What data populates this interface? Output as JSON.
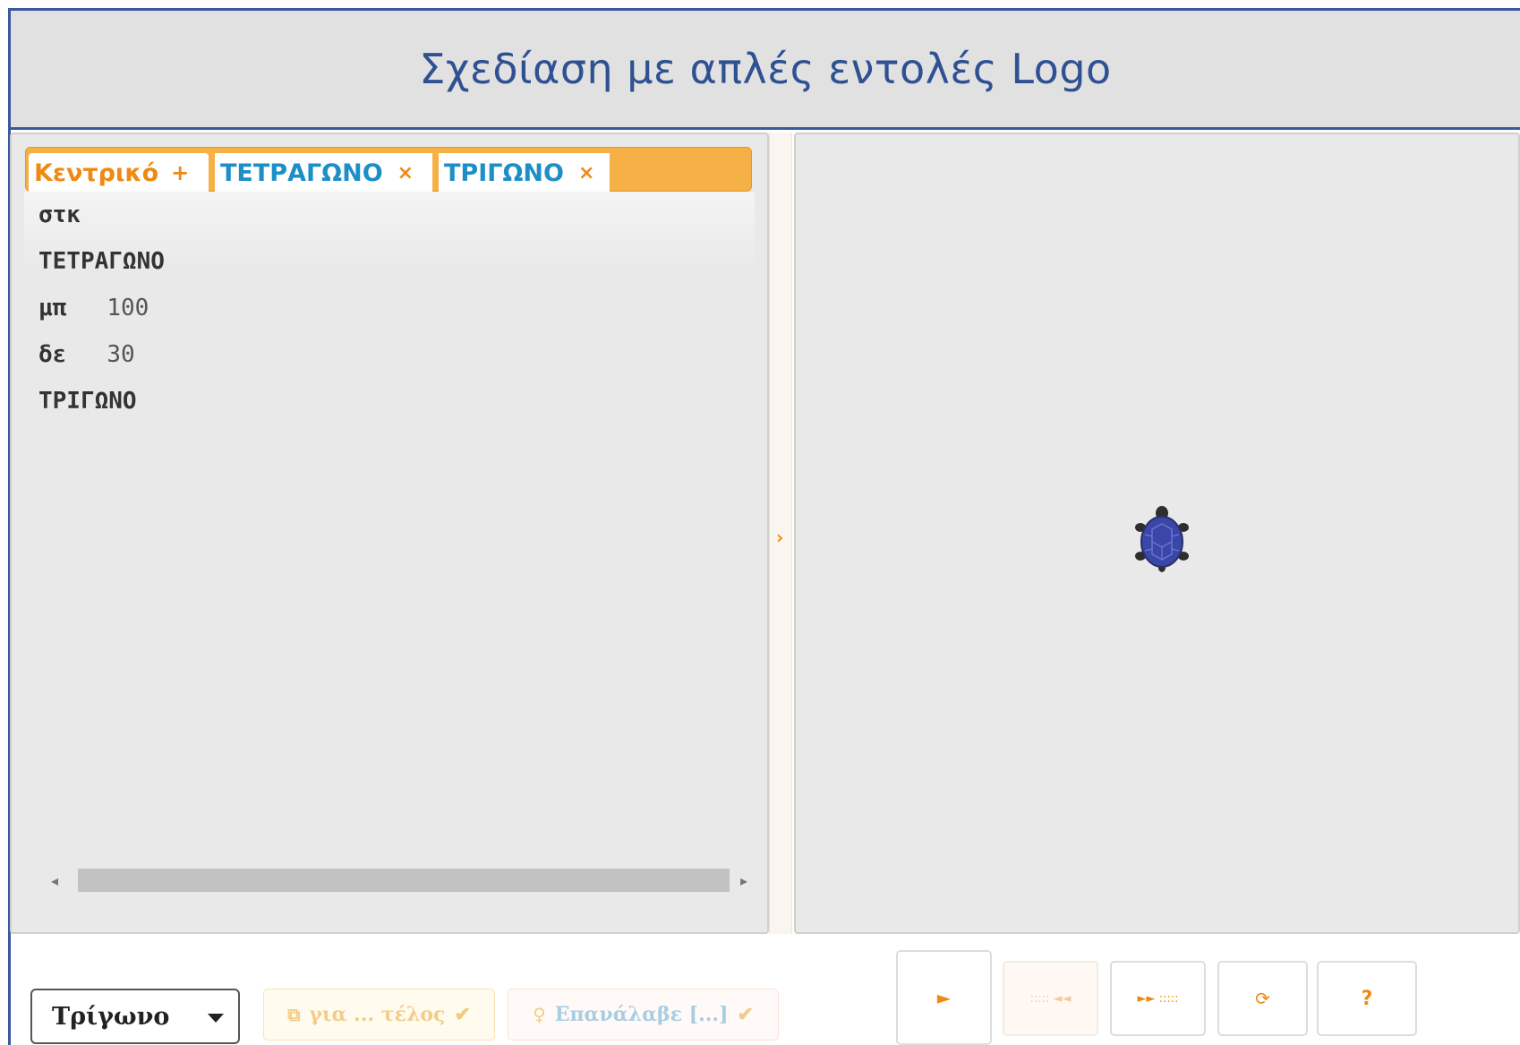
{
  "header": {
    "title": "Σχεδίαση με απλές εντολές Logo"
  },
  "tabs": {
    "main": {
      "label": "Κεντρικό",
      "action": "+"
    },
    "square": {
      "label": "ΤΕΤΡΑΓΩΝΟ",
      "action": "×"
    },
    "triangle": {
      "label": "ΤΡΙΓΩΝΟ",
      "action": "×"
    }
  },
  "code": {
    "lines": [
      {
        "cmd": "στκ",
        "arg": ""
      },
      {
        "cmd": "ΤΕΤΡΑΓΩΝΟ",
        "arg": ""
      },
      {
        "cmd": "μπ",
        "arg": "100"
      },
      {
        "cmd": "δε",
        "arg": "30"
      },
      {
        "cmd": "ΤΡΙΓΩΝΟ",
        "arg": ""
      }
    ]
  },
  "controls": {
    "procedure_select": {
      "value": "Τρίγωνο"
    },
    "for_end_button": {
      "label": "για ... τέλος"
    },
    "repeat_button": {
      "label": "Επανάλαβε [...]"
    },
    "run_label": "►",
    "back_label": "::::: ◄◄",
    "forward_label": "►► :::::",
    "reset_label": "⟳",
    "help_label": "?"
  },
  "colors": {
    "header_title": "#2f5192",
    "accent": "#ee8a14",
    "tab_blue": "#1c8fc7",
    "turtle_shell": "#3b47a8"
  },
  "icons": {
    "splitter": "chevron-right-icon",
    "turtle": "turtle-icon"
  }
}
